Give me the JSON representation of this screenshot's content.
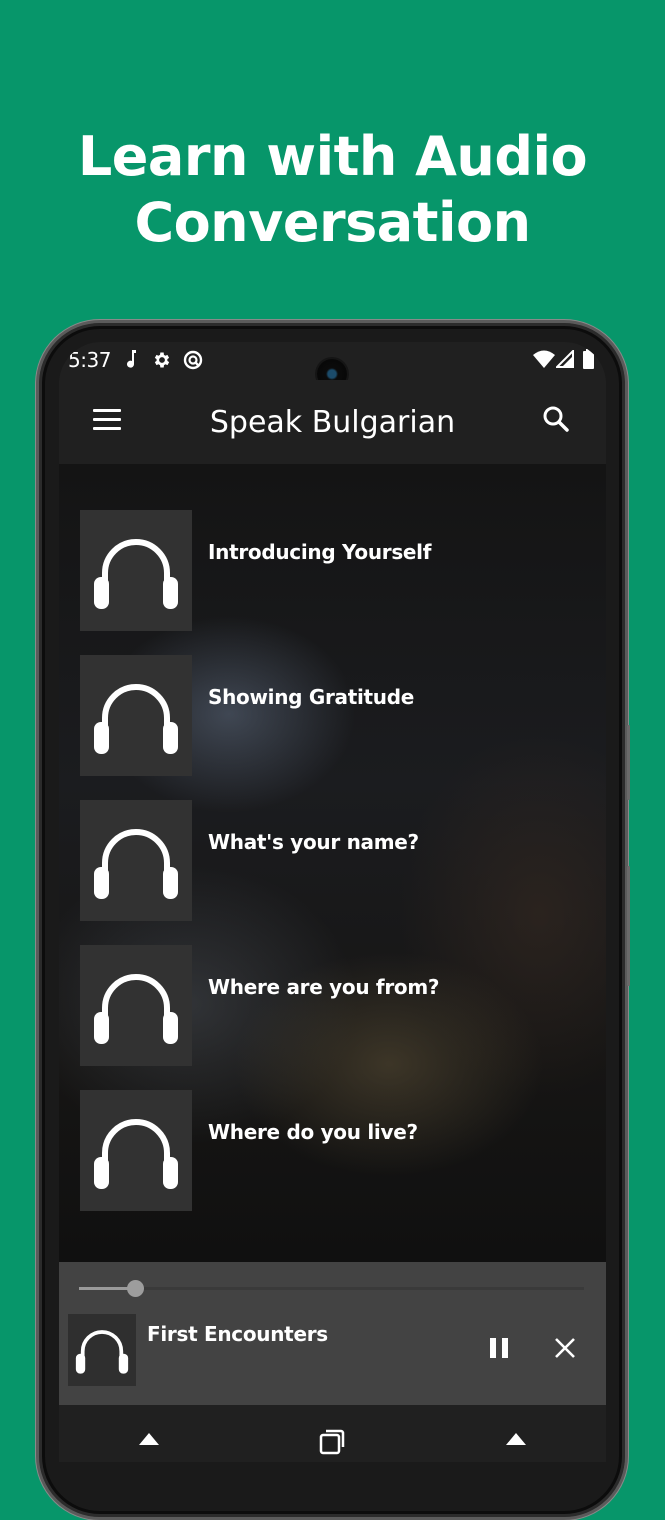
{
  "promo": {
    "headline_line1": "Learn with Audio",
    "headline_line2": "Conversation"
  },
  "status_bar": {
    "time": "5:37",
    "left_icons": [
      "music-note-icon",
      "gear-icon",
      "at-sign-icon"
    ],
    "right_icons": [
      "wifi-icon",
      "cell-signal-icon",
      "battery-icon"
    ]
  },
  "app_bar": {
    "title": "Speak Bulgarian",
    "menu_icon": "hamburger-menu-icon",
    "search_icon": "search-icon"
  },
  "lessons": [
    {
      "title": "Introducing Yourself",
      "icon": "headphones-icon"
    },
    {
      "title": "Showing Gratitude",
      "icon": "headphones-icon"
    },
    {
      "title": "What's your name?",
      "icon": "headphones-icon"
    },
    {
      "title": "Where are you from?",
      "icon": "headphones-icon"
    },
    {
      "title": "Where do you live?",
      "icon": "headphones-icon"
    }
  ],
  "player": {
    "now_playing": "First Encounters",
    "progress_fraction": 0.11,
    "pause_icon": "pause-icon",
    "close_icon": "close-icon"
  },
  "nav_bar": {
    "buttons": [
      "back-icon",
      "recents-icon",
      "home-icon"
    ]
  },
  "colors": {
    "background": "#07966a",
    "app_bar": "#202020",
    "player": "#434343",
    "thumb": "#323232"
  }
}
